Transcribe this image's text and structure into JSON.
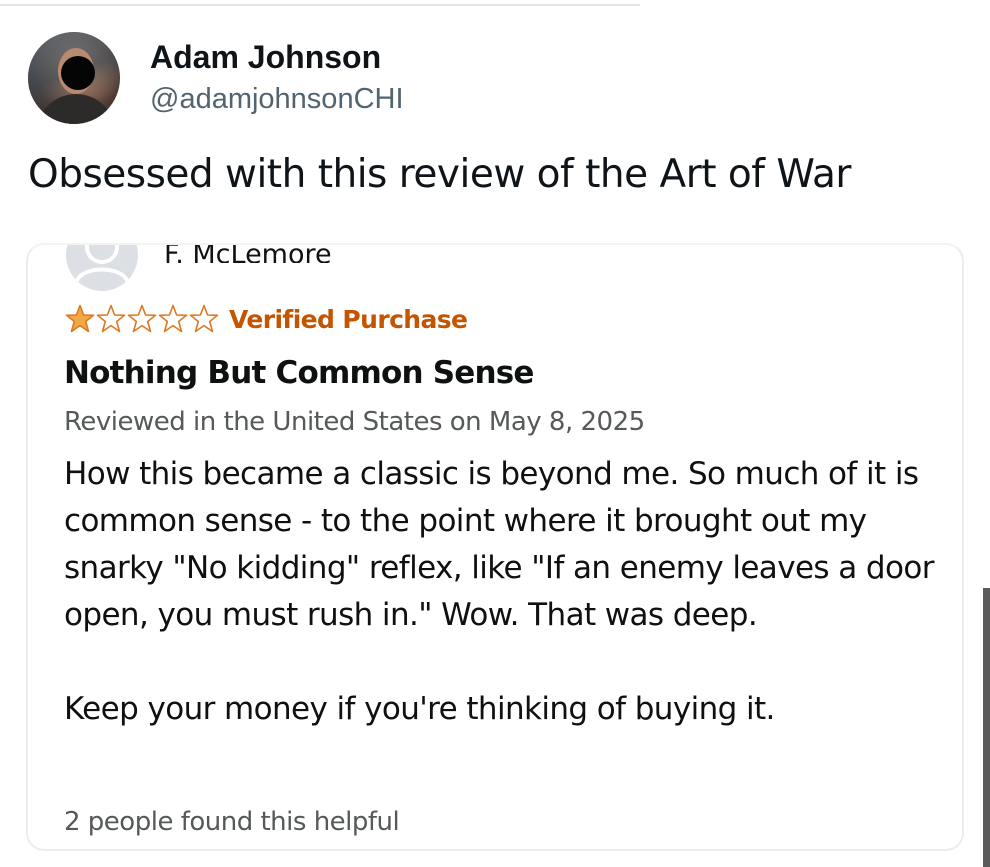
{
  "tweet": {
    "author": {
      "display_name": "Adam Johnson",
      "handle": "@adamjohnsonCHI"
    },
    "text": "Obsessed with this review of the Art of War"
  },
  "review": {
    "reviewer_name": "F. McLemore",
    "rating": 1,
    "max_rating": 5,
    "verified_label": "Verified Purchase",
    "title": "Nothing But Common Sense",
    "meta": "Reviewed in the United States on May 8, 2025",
    "body_paragraph_1": "How this became a classic is beyond me. So much of it is common sense - to the point where it brought out my snarky \"No kidding\" reflex, like \"If an enemy leaves a door open, you must rush in.\" Wow. That was deep.",
    "body_paragraph_2": "Keep your money if you're thinking of buying it.",
    "helpful": "2 people found this helpful"
  },
  "colors": {
    "star_filled": "#f3a847",
    "star_filled_stroke": "#de7921",
    "star_empty_stroke": "#de7921",
    "verified": "#c45500",
    "meta": "#565959",
    "handle": "#536471"
  },
  "icons": {
    "star": "star-icon",
    "reviewer_avatar": "user-silhouette-icon"
  }
}
